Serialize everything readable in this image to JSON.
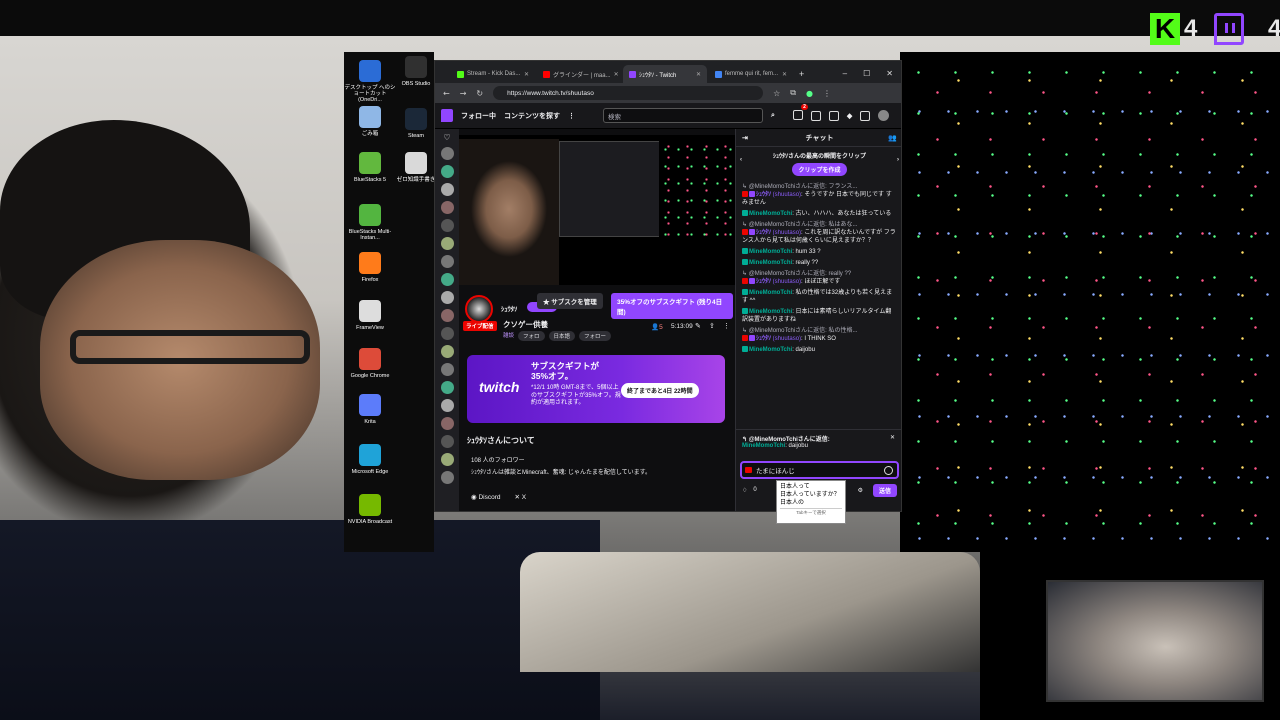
{
  "overlay": {
    "kick_count": "4",
    "twitch_count": "4"
  },
  "desktop": {
    "icons": [
      {
        "label": "デスクトップ へのショートカット (OneDri...",
        "color": "#2b6cd6"
      },
      {
        "label": "OBS Studio",
        "color": "#303030"
      },
      {
        "label": "ごみ箱",
        "color": "#8fb7e6"
      },
      {
        "label": "Steam",
        "color": "#1b2838"
      },
      {
        "label": "BlueStacks 5",
        "color": "#62b83e"
      },
      {
        "label": "ゼロ知識手書き",
        "color": "#d9d9d9"
      },
      {
        "label": "BlueStacks Multi-Instan...",
        "color": "#53b540"
      },
      {
        "label": "Firefox",
        "color": "#ff7b1a"
      },
      {
        "label": "FrameView",
        "color": "#dddddd"
      },
      {
        "label": "Google Chrome",
        "color": "#dd4b39"
      },
      {
        "label": "Krita",
        "color": "#5c7cfa"
      },
      {
        "label": "Microsoft Edge",
        "color": "#1fa3d8"
      },
      {
        "label": "NVIDIA Broadcast",
        "color": "#76b900"
      }
    ]
  },
  "browser": {
    "tabs": [
      {
        "label": "Stream - Kick Das...",
        "color": "#53fc18",
        "active": false
      },
      {
        "label": "グラインダー | maa...",
        "color": "#ff0000",
        "active": false
      },
      {
        "label": "ｼｭｳﾀｿ - Twitch",
        "color": "#9146ff",
        "active": true
      },
      {
        "label": "femme qui rit, fem...",
        "color": "#4285f4",
        "active": false
      }
    ],
    "url": "https://www.twitch.tv/shuutaso"
  },
  "twitch": {
    "nav": {
      "following": "フォロー中",
      "browse": "コンテンツを探す",
      "more": "⋮",
      "search_placeholder": "検索",
      "notif_count": "2"
    },
    "channel": {
      "name": "ｼｭｳﾀｿ",
      "live_badge": "ライブ配信",
      "title": "クソゲー供養",
      "tags": [
        "雑談",
        "フォロ",
        "日本語",
        "フォロー"
      ],
      "manage_sub": "★ サブスクを管理",
      "gift_btn": "35%オフのサブスクギフト (残り4日間)",
      "viewers": "5",
      "uptime": "5:13:09"
    },
    "promo": {
      "logo": "twitch",
      "heading": "サブスクギフトが35%オフ。",
      "body": "*12/1 10時 GMT-8まで、5個以上のサブスクギフトが35%オフ。規約が適用されます。",
      "pill": "終了まであと4日 22時間"
    },
    "about": {
      "title": "ｼｭｳﾀｿさんについて",
      "followers": "108 人のフォロワー",
      "description": "ｼｭｳﾀｿさんは雑談とMinecraft、奮魂: じゃんたまを配信しています。",
      "discord": "Discord",
      "x": "X"
    },
    "chat": {
      "header": "チャット",
      "clip_prompt": "ｼｭｳﾀｿさんの最高の瞬間をクリップ",
      "clip_btn": "クリップを作成",
      "messages": [
        {
          "ctx": "@MineMomoTchiさんに返信: フランス...",
          "user": "ｼｭｳﾀｿ",
          "handle": "(shuutaso)",
          "text": ": そうですか 日本でも同じです すみません",
          "type": "streamer"
        },
        {
          "user": "MineMomoTchi",
          "text": ": 古い、ハハハ、あなたは狂っている",
          "type": "viewer"
        },
        {
          "ctx": "@MineMomoTchiさんに返信: 私はあな...",
          "user": "ｼｭｳﾀｿ",
          "handle": "(shuutaso)",
          "text": ": これを周に訳なたいんですが フランス人から見て私は何歳くらいに見えますか？？",
          "type": "streamer"
        },
        {
          "user": "MineMomoTchi",
          "text": ": hum 33 ?",
          "type": "viewer"
        },
        {
          "user": "MineMomoTchi",
          "text": ": really ??",
          "type": "viewer"
        },
        {
          "ctx": "@MineMomoTchiさんに返信: really ??",
          "user": "ｼｭｳﾀｿ",
          "handle": "(shuutaso)",
          "text": ": ほぼ正解です",
          "type": "streamer"
        },
        {
          "user": "MineMomoTchi",
          "text": ": 私の性格では32歳よりも若く見えます ^^",
          "type": "viewer"
        },
        {
          "user": "MineMomoTchi",
          "text": ": 日本には素晴らしいリアルタイム翻訳装置がありますね",
          "type": "viewer"
        },
        {
          "ctx": "@MineMomoTchiさんに返信: 私の性格...",
          "user": "ｼｭｳﾀｿ",
          "handle": "(shuutaso)",
          "text": ": I THINK SO",
          "type": "streamer"
        },
        {
          "user": "MineMomoTchi",
          "text": ": daijobu",
          "type": "viewer"
        }
      ],
      "reply_title": "@MineMomoTchiさんに返信:",
      "reply_user": "MineMomoTchi",
      "reply_text": ": daijobu",
      "input_value": "たまにほんじ",
      "points": "0",
      "send": "送信"
    }
  },
  "ime": {
    "candidates": [
      "日本人って",
      "日本人っていますか？",
      "日本人の"
    ],
    "footer": "Tabキーで選択"
  }
}
